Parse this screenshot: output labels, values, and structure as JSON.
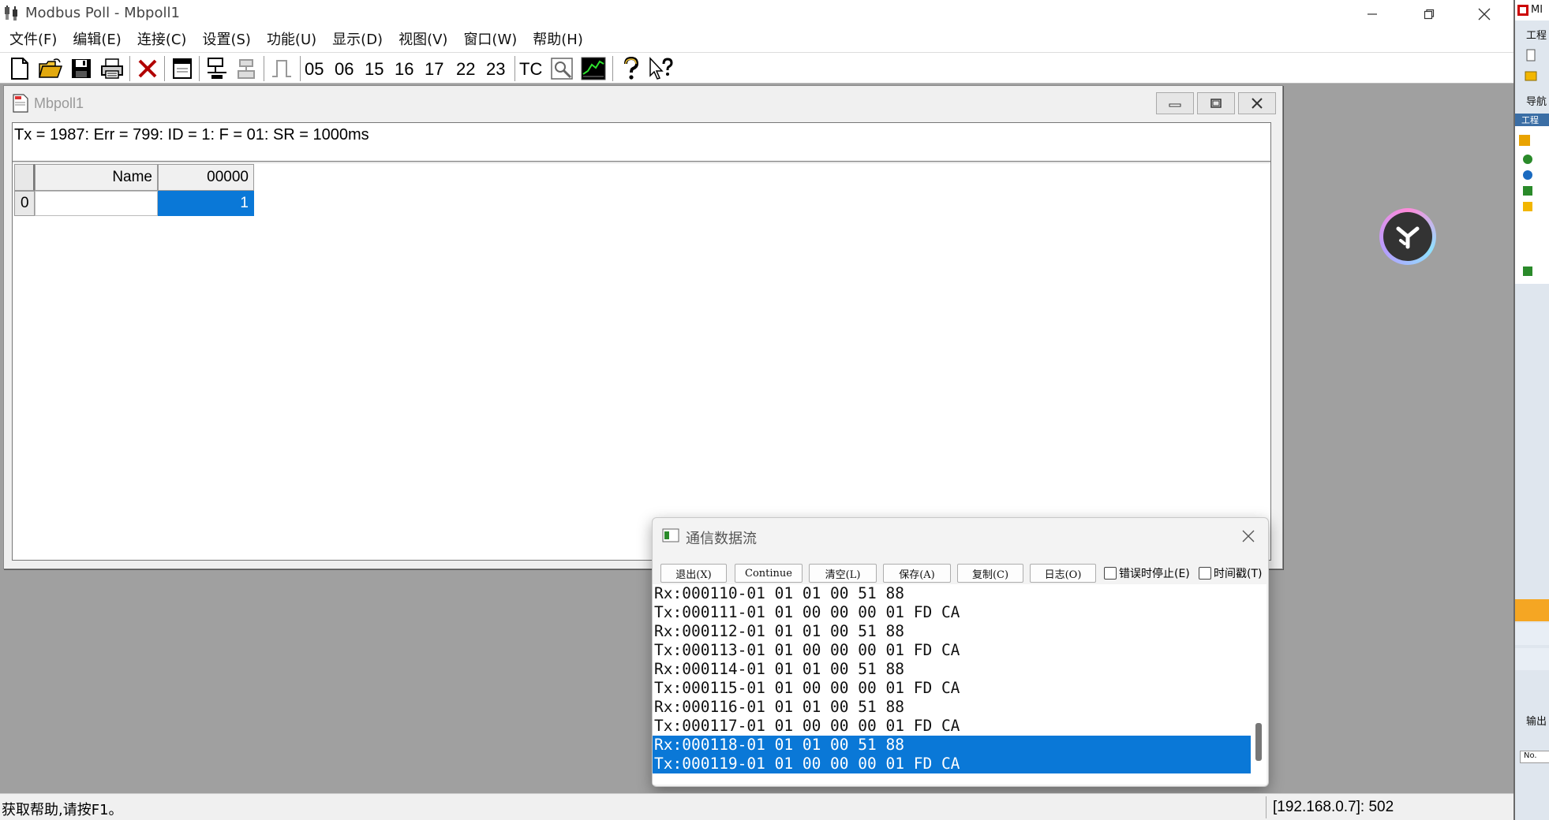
{
  "app": {
    "title": "Modbus Poll - Mbpoll1",
    "icon": "modbus-plug-icon"
  },
  "menu": [
    "文件(F)",
    "编辑(E)",
    "连接(C)",
    "设置(S)",
    "功能(U)",
    "显示(D)",
    "视图(V)",
    "窗口(W)",
    "帮助(H)"
  ],
  "toolbar": {
    "icons": [
      "new-file-icon",
      "open-folder-icon",
      "save-disk-icon",
      "print-icon",
      "delete-x-icon",
      "window-icon",
      "connect-icon",
      "disconnect-icon",
      "pulse-icon",
      "traffic-icon",
      "chart-icon",
      "help-icon",
      "context-help-icon"
    ],
    "function_codes": [
      "05",
      "06",
      "15",
      "16",
      "17",
      "22",
      "23"
    ],
    "tc_label": "TC"
  },
  "child": {
    "title": "Mbpoll1",
    "status_line": "Tx = 1987: Err = 799: ID = 1: F = 01: SR = 1000ms",
    "grid": {
      "columns": [
        "Name",
        "00000"
      ],
      "rows": [
        {
          "index": "0",
          "name": "",
          "value": "1"
        }
      ]
    }
  },
  "traffic": {
    "title": "通信数据流",
    "buttons": {
      "exit": "退出(X)",
      "continue": "Continue",
      "clear": "清空(L)",
      "save": "保存(A)",
      "copy": "复制(C)",
      "log": "日志(O)"
    },
    "checks": {
      "stop_on_error": "错误时停止(E)",
      "timestamp": "时间戳(T)"
    },
    "lines": [
      "Rx:000110-01 01 01 00 51 88",
      "Tx:000111-01 01 00 00 00 01 FD CA",
      "Rx:000112-01 01 01 00 51 88",
      "Tx:000113-01 01 00 00 00 01 FD CA",
      "Rx:000114-01 01 01 00 51 88",
      "Tx:000115-01 01 00 00 00 01 FD CA",
      "Rx:000116-01 01 01 00 51 88",
      "Tx:000117-01 01 00 00 00 01 FD CA",
      "Rx:000118-01 01 01 00 51 88",
      "Tx:000119-01 01 00 00 00 01 FD CA"
    ],
    "highlighted": [
      8,
      9
    ]
  },
  "statusbar": {
    "help": "获取帮助,请按F1。",
    "connection": "[192.168.0.7]: 502"
  },
  "side_app": {
    "labels": [
      "MI",
      "工程",
      "导航",
      "工程",
      "输出",
      "No."
    ]
  },
  "colors": {
    "selection": "#0a78d7",
    "mdi_background": "#a0a0a0"
  }
}
